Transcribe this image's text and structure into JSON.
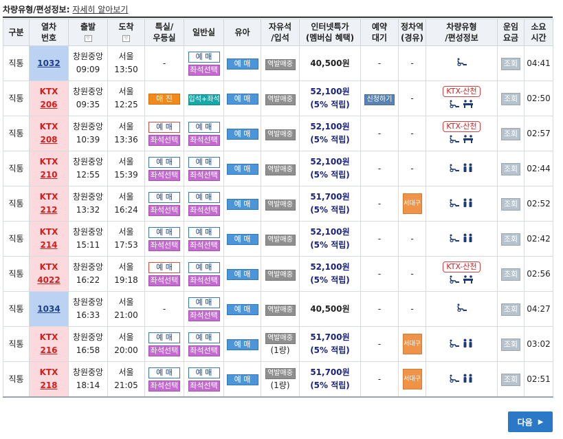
{
  "header": {
    "title": "차량유형/편성정보:",
    "link_text": "자세히 알아보기"
  },
  "columns": [
    "구분",
    "열차\n번호",
    "출발",
    "도착",
    "특실/\n우등실",
    "일반실",
    "유아",
    "자유석\n/입석",
    "인터넷특가\n(멤버십 혜택)",
    "예약\n대기",
    "정차역\n(경유)",
    "차량유형\n/편성정보",
    "운임\n요금",
    "소요\n시간"
  ],
  "labels": {
    "reserve": "예 매",
    "seat_select": "좌석선택",
    "sold_out": "매 진",
    "standing_plus_seat": "입석+좌석",
    "infant_reserve": "예 매",
    "station_sale": "역발매중",
    "one_car": "(1량)",
    "apply_wait": "신청하기",
    "dash": "-",
    "west_daegu": "서대구",
    "ktx_sancheon": "KTX-산천",
    "lookup": "조회",
    "reward": "(5% 적립)",
    "ktx": "KTX"
  },
  "rows": [
    {
      "kind": "직통",
      "train_type": "",
      "train_no": "1032",
      "dep_station": "창원중앙",
      "dep_time": "09:09",
      "arr_station": "서울",
      "arr_time": "13:50",
      "first": "none",
      "general": "reserve_seat",
      "car_note": false,
      "price": "40,500원",
      "reward": false,
      "wait": "dash",
      "stop": "dash",
      "vehicle": "mugunghwa",
      "duration": "04:41"
    },
    {
      "kind": "직통",
      "train_type": "KTX",
      "train_no": "206",
      "dep_station": "창원중앙",
      "dep_time": "09:35",
      "arr_station": "서울",
      "arr_time": "12:25",
      "first": "soldout",
      "general": "standing",
      "car_note": false,
      "price": "52,100원",
      "reward": true,
      "wait": "apply",
      "stop": "dash",
      "vehicle": "sancheon",
      "duration": "02:50"
    },
    {
      "kind": "직통",
      "train_type": "KTX",
      "train_no": "208",
      "dep_station": "창원중앙",
      "dep_time": "10:39",
      "arr_station": "서울",
      "arr_time": "13:36",
      "first": "reserve_seat_red",
      "general": "reserve_seat",
      "car_note": false,
      "price": "52,100원",
      "reward": true,
      "wait": "dash",
      "stop": "dash",
      "vehicle": "sancheon",
      "duration": "02:57"
    },
    {
      "kind": "직통",
      "train_type": "KTX",
      "train_no": "210",
      "dep_station": "창원중앙",
      "dep_time": "12:55",
      "arr_station": "서울",
      "arr_time": "15:39",
      "first": "reserve_seat",
      "general": "reserve_seat",
      "car_note": false,
      "price": "52,100원",
      "reward": true,
      "wait": "dash",
      "stop": "dash",
      "vehicle": "ktx",
      "duration": "02:44"
    },
    {
      "kind": "직통",
      "train_type": "KTX",
      "train_no": "212",
      "dep_station": "창원중앙",
      "dep_time": "13:32",
      "arr_station": "서울",
      "arr_time": "16:24",
      "first": "reserve_seat",
      "general": "reserve_seat",
      "car_note": false,
      "price": "51,700원",
      "reward": true,
      "wait": "dash",
      "stop": "west",
      "vehicle": "ktx",
      "duration": "02:52"
    },
    {
      "kind": "직통",
      "train_type": "KTX",
      "train_no": "214",
      "dep_station": "창원중앙",
      "dep_time": "15:11",
      "arr_station": "서울",
      "arr_time": "17:53",
      "first": "reserve_seat",
      "general": "reserve_seat",
      "car_note": false,
      "price": "52,100원",
      "reward": true,
      "wait": "dash",
      "stop": "dash",
      "vehicle": "ktx",
      "duration": "02:42"
    },
    {
      "kind": "직통",
      "train_type": "KTX",
      "train_no": "4022",
      "dep_station": "창원중앙",
      "dep_time": "16:22",
      "arr_station": "서울",
      "arr_time": "19:18",
      "first": "reserve_seat_red",
      "general": "reserve_seat",
      "car_note": false,
      "price": "52,100원",
      "reward": true,
      "wait": "dash",
      "stop": "dash",
      "vehicle": "sancheon",
      "duration": "02:56"
    },
    {
      "kind": "직통",
      "train_type": "",
      "train_no": "1034",
      "dep_station": "창원중앙",
      "dep_time": "16:33",
      "arr_station": "서울",
      "arr_time": "21:00",
      "first": "none",
      "general": "reserve_seat",
      "car_note": false,
      "price": "40,500원",
      "reward": false,
      "wait": "dash",
      "stop": "dash",
      "vehicle": "mugunghwa",
      "duration": "04:27"
    },
    {
      "kind": "직통",
      "train_type": "KTX",
      "train_no": "216",
      "dep_station": "창원중앙",
      "dep_time": "16:58",
      "arr_station": "서울",
      "arr_time": "20:00",
      "first": "reserve_seat",
      "general": "reserve_seat",
      "car_note": true,
      "price": "51,700원",
      "reward": true,
      "wait": "dash",
      "stop": "west",
      "vehicle": "ktx",
      "duration": "03:02"
    },
    {
      "kind": "직통",
      "train_type": "KTX",
      "train_no": "218",
      "dep_station": "창원중앙",
      "dep_time": "18:14",
      "arr_station": "서울",
      "arr_time": "21:05",
      "first": "reserve_seat",
      "general": "reserve_seat",
      "car_note": true,
      "price": "51,700원",
      "reward": true,
      "wait": "dash",
      "stop": "west",
      "vehicle": "ktx",
      "duration": "02:51"
    }
  ],
  "next_button": "다음",
  "icons": {
    "sort": "sort-triangle-icon",
    "next": "chevron-right-icon",
    "wheelchair": "wheelchair-icon",
    "people": "people-icon",
    "family_seat": "family-seat-icon"
  },
  "colors": {
    "accent": "#2a78c6",
    "ktx_red": "#d21d1d",
    "seat_select": "#c46bd0",
    "sold_out": "#f28a1b",
    "infant": "#4c95d9"
  }
}
